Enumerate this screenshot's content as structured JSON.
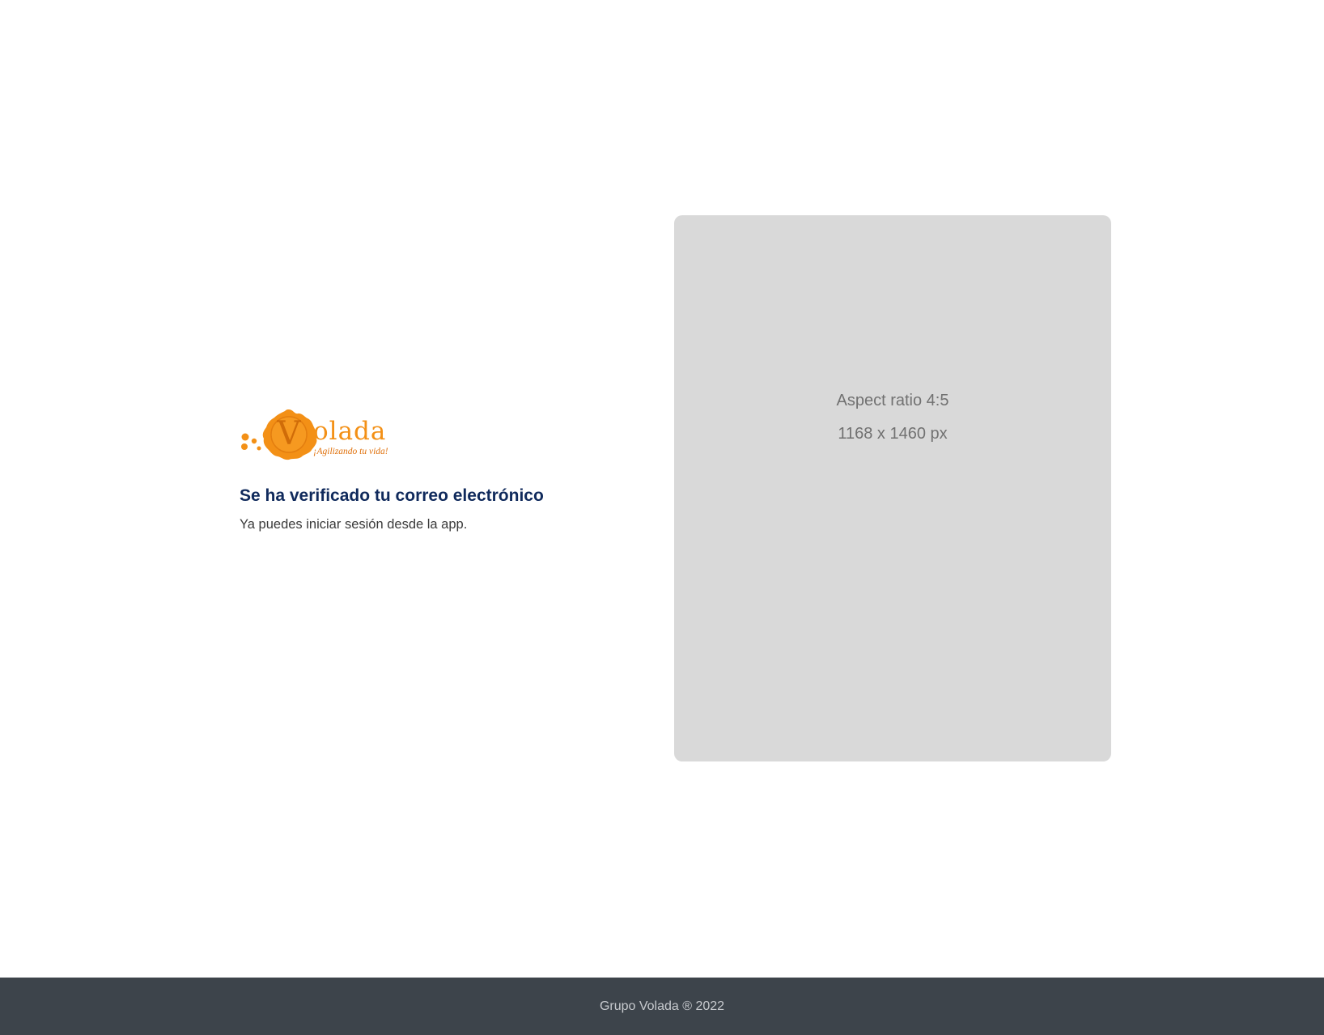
{
  "brand": {
    "logo_word": "olada",
    "logo_letter": "V",
    "logo_tagline": "¡Agilizando tu vida!",
    "accent_color": "#f39016"
  },
  "message": {
    "title": "Se ha verificado tu correo electrónico",
    "body": "Ya puedes iniciar sesión desde la app."
  },
  "image_placeholder": {
    "line1": "Aspect ratio 4:5",
    "line2": "1168 x 1460 px",
    "background": "#d9d9d9"
  },
  "footer": {
    "text": "Grupo Volada ® 2022",
    "background": "#3d444b"
  }
}
